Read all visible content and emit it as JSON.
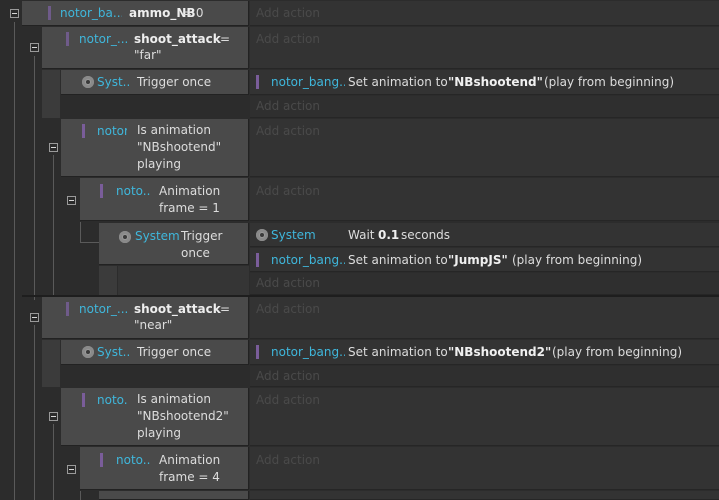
{
  "add_action": "Add action",
  "events": {
    "e1": {
      "object": "notor_ba...",
      "variable": "ammo_NB",
      "op": "= 0"
    },
    "e2": {
      "object": "notor_...",
      "variable": "shoot_attack",
      "op": "=",
      "value": "\"far\""
    },
    "e2a": {
      "object": "Syst...",
      "condition": "Trigger once",
      "action_object": "notor_bang...",
      "action_prefix": "Set animation to",
      "action_value": "\"NBshootend\"",
      "action_suffix": "(play from beginning)"
    },
    "e2b": {
      "object": "notor...",
      "condition_lines": [
        "Is animation",
        "\"NBshootend\"",
        "playing"
      ]
    },
    "e2b1": {
      "object": "noto...",
      "condition_lines": [
        "Animation",
        "frame = 1"
      ]
    },
    "e2b1a": {
      "object": "System",
      "condition_lines": [
        "Trigger",
        "once"
      ],
      "actions": [
        {
          "object": "System",
          "prefix": "Wait",
          "value": "0.1",
          "suffix": "seconds"
        },
        {
          "object": "notor_bang...",
          "prefix": "Set animation to",
          "value": "\"JumpJS\"",
          "suffix": "(play from beginning)"
        }
      ]
    },
    "e3": {
      "object": "notor_...",
      "variable": "shoot_attack",
      "op": "=",
      "value": "\"near\""
    },
    "e3a": {
      "object": "Syst...",
      "condition": "Trigger once",
      "action_object": "notor_bang...",
      "action_prefix": "Set animation to",
      "action_value": "\"NBshootend2\"",
      "action_suffix": "(play from beginning)"
    },
    "e3b": {
      "object": "noto...",
      "condition_lines": [
        "Is animation",
        "\"NBshootend2\"",
        "playing"
      ]
    },
    "e3b1": {
      "object": "noto...",
      "condition_lines": [
        "Animation",
        "frame = 4"
      ]
    }
  }
}
